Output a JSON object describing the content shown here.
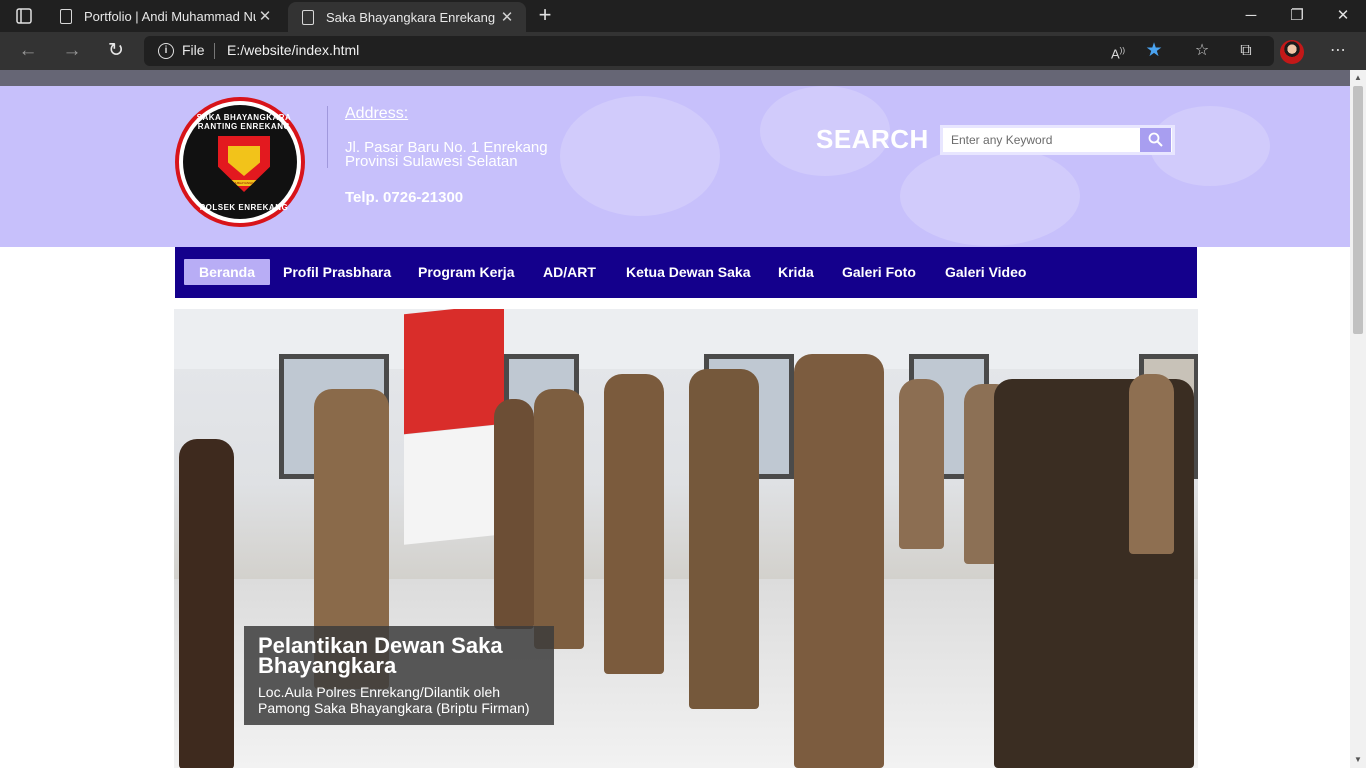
{
  "browser": {
    "tabs": [
      {
        "label": "Portfolio | Andi Muhammad Nur"
      },
      {
        "label": "Saka Bhayangkara Enrekang"
      }
    ],
    "address": {
      "scheme_label": "File",
      "url": "E:/website/index.html"
    },
    "icons": [
      "back-icon",
      "forward-icon",
      "refresh-icon",
      "info-icon",
      "read-aloud-icon",
      "favorite-star-icon",
      "favorites-icon",
      "collections-icon",
      "profile-avatar",
      "more-icon"
    ]
  },
  "header": {
    "logo": {
      "ring_top_text": "SAKA BHAYANGKARA RANTING ENREKANG",
      "ring_bottom_text": "POLSEK ENREKANG",
      "band_text": "SAKA BHAYANGKARA"
    },
    "address_title": "Address:",
    "address_line1": "Jl. Pasar Baru No. 1 Enrekang",
    "address_line2": "Provinsi Sulawesi Selatan",
    "phone": "Telp. 0726-21300",
    "search_label": "SEARCH",
    "search_placeholder": "Enter any Keyword"
  },
  "nav": {
    "items": [
      {
        "label": "Beranda",
        "active": true
      },
      {
        "label": "Profil Prasbhara"
      },
      {
        "label": "Program Kerja"
      },
      {
        "label": "AD/ART"
      },
      {
        "label": "Ketua Dewan Saka"
      },
      {
        "label": "Krida"
      },
      {
        "label": "Galeri Foto"
      },
      {
        "label": "Galeri Video"
      }
    ]
  },
  "slider": {
    "caption_title": "Pelantikan Dewan Saka Bhayangkara",
    "caption_text": "Loc.Aula Polres Enrekang/Dilantik oleh Pamong Saka Bhayangkara (Briptu Firman)"
  },
  "colors": {
    "header_bg": "#c7c0fb",
    "nav_bg": "#14008c",
    "nav_active_bg": "#b8adf5",
    "logo_red": "#d8141a"
  }
}
